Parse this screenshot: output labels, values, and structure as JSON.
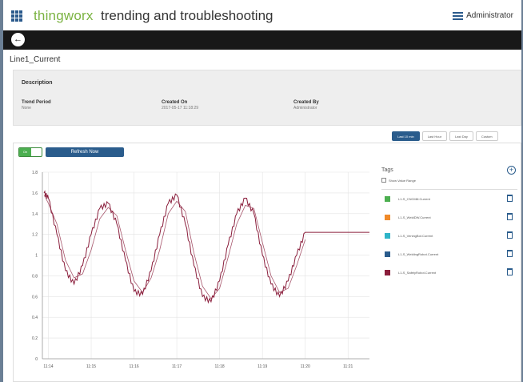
{
  "header": {
    "brand": "thingworx",
    "app_title": "trending and troubleshooting",
    "user": "Administrator"
  },
  "page": {
    "title": "Line1_Current"
  },
  "description": {
    "heading": "Description",
    "fields": [
      {
        "label": "Trend Period",
        "value": "None"
      },
      {
        "label": "Created On",
        "value": "2017-05-17 11:18:29"
      },
      {
        "label": "Created By",
        "value": "Administrator"
      }
    ]
  },
  "time_ranges": [
    "Last 10 min",
    "Last Hour",
    "Last Day",
    "Custom"
  ],
  "controls": {
    "toggle_label": "On",
    "refresh_label": "Refresh Now"
  },
  "tags_panel": {
    "heading": "Tags",
    "show_value_range": "Show Value Range",
    "tags": [
      {
        "name": "L1-S_CNCMill.Current",
        "color": "#4caf50"
      },
      {
        "name": "L1-S_WeldDW.Current",
        "color": "#f08a2a"
      },
      {
        "name": "L1-S_VeningBot.Current",
        "color": "#2fb4c8"
      },
      {
        "name": "L1-S_WeldingRobot.Current",
        "color": "#2a5c8c"
      },
      {
        "name": "L1-S_SafetyRobot.Current",
        "color": "#8a1d3b"
      }
    ]
  },
  "colors": {
    "accent": "#2a5c8c",
    "brand": "#7bb342",
    "nav": "#181818",
    "series": "#8a1d3b"
  },
  "chart_data": {
    "type": "line",
    "title": "",
    "xlabel": "",
    "ylabel": "",
    "ylim": [
      0,
      1.8
    ],
    "yticks": [
      "0",
      "0.2",
      "0.4",
      "0.6",
      "0.8",
      "1",
      "1.2",
      "1.4",
      "1.6",
      "1.8"
    ],
    "xlim": [
      13.86,
      21.5
    ],
    "xticks": [
      "11:14",
      "11:15",
      "11:16",
      "11:17",
      "11:18",
      "11:19",
      "11:20",
      "11:21"
    ],
    "grid": true,
    "legend": "none",
    "series": [
      {
        "x": [
          13.9,
          14.0,
          14.2,
          14.4,
          14.6,
          14.8,
          15.0,
          15.2,
          15.4,
          15.6,
          15.8,
          16.0,
          16.2,
          16.4,
          16.6,
          16.8,
          17.0,
          17.2,
          17.4,
          17.6,
          17.8,
          18.0,
          18.2,
          18.4,
          18.6,
          18.8,
          19.0,
          19.2,
          19.4,
          19.6,
          19.8,
          20.0,
          21.5
        ],
        "y": [
          1.6,
          1.55,
          1.2,
          0.85,
          0.72,
          0.9,
          1.2,
          1.45,
          1.5,
          1.3,
          0.95,
          0.65,
          0.62,
          0.85,
          1.2,
          1.5,
          1.58,
          1.3,
          0.9,
          0.6,
          0.55,
          0.75,
          1.1,
          1.4,
          1.55,
          1.4,
          1.0,
          0.72,
          0.6,
          0.75,
          1.0,
          1.22,
          1.22
        ]
      },
      {
        "x": [
          13.9,
          14.0,
          14.2,
          14.4,
          14.6,
          14.8,
          15.0,
          15.2,
          15.4,
          15.6,
          15.8,
          16.0,
          16.2,
          16.4,
          16.6,
          16.8,
          17.0,
          17.2,
          17.4,
          17.6,
          17.8,
          18.0,
          18.2,
          18.4,
          18.6,
          18.8,
          19.0,
          19.2,
          19.4,
          19.6,
          19.8,
          20.0
        ],
        "y": [
          1.58,
          1.5,
          1.3,
          0.95,
          0.78,
          0.82,
          1.05,
          1.35,
          1.46,
          1.38,
          1.05,
          0.75,
          0.64,
          0.78,
          1.05,
          1.4,
          1.52,
          1.42,
          1.02,
          0.7,
          0.58,
          0.68,
          0.98,
          1.3,
          1.48,
          1.45,
          1.12,
          0.8,
          0.64,
          0.68,
          0.9,
          1.15
        ]
      }
    ]
  }
}
